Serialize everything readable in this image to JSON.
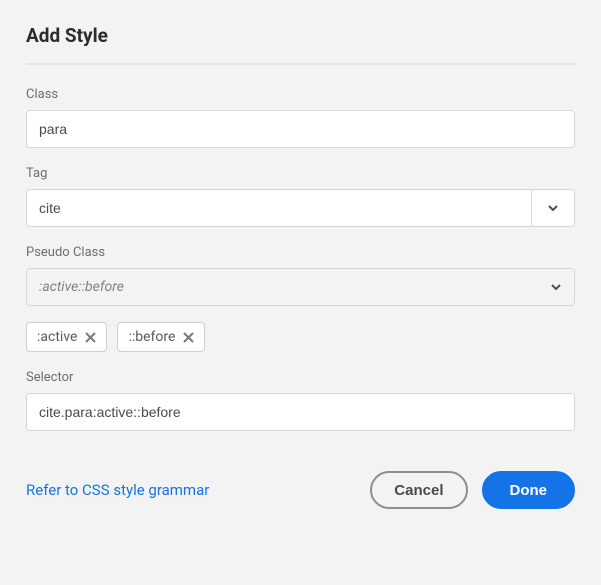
{
  "title": "Add Style",
  "fields": {
    "class": {
      "label": "Class",
      "value": "para"
    },
    "tag": {
      "label": "Tag",
      "value": "cite"
    },
    "pseudo": {
      "label": "Pseudo Class",
      "placeholder": ":active::before"
    },
    "selector": {
      "label": "Selector",
      "value": "cite.para:active::before"
    }
  },
  "chips": [
    {
      "label": ":active"
    },
    {
      "label": "::before"
    }
  ],
  "footer": {
    "link": "Refer to CSS style grammar",
    "cancel": "Cancel",
    "done": "Done"
  }
}
